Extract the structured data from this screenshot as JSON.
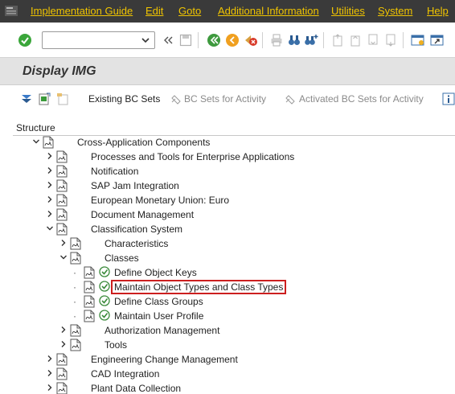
{
  "menu": {
    "items": [
      "Implementation Guide",
      "Edit",
      "Goto",
      "Additional Information",
      "Utilities",
      "System",
      "Help"
    ]
  },
  "toolbar": {
    "command_field_value": ""
  },
  "title": "Display IMG",
  "app_toolbar": {
    "existing_bc_sets": "Existing BC Sets",
    "bc_sets_for_activity": "BC Sets for Activity",
    "activated_bc_sets_for_activity": "Activated BC Sets for Activity"
  },
  "structure": {
    "header": "Structure",
    "nodes": [
      {
        "label": "Cross-Application Components",
        "state": "expanded"
      },
      {
        "label": "Processes and Tools for Enterprise Applications",
        "state": "collapsed"
      },
      {
        "label": "Notification",
        "state": "collapsed"
      },
      {
        "label": "SAP Jam Integration",
        "state": "collapsed"
      },
      {
        "label": "European Monetary Union: Euro",
        "state": "collapsed"
      },
      {
        "label": "Document Management",
        "state": "collapsed"
      },
      {
        "label": "Classification System",
        "state": "expanded"
      },
      {
        "label": "Characteristics",
        "state": "collapsed"
      },
      {
        "label": "Classes",
        "state": "expanded"
      },
      {
        "label": "Define Object Keys",
        "state": "leaf"
      },
      {
        "label": "Maintain Object Types and Class Types",
        "state": "leaf",
        "highlighted": true
      },
      {
        "label": "Define Class Groups",
        "state": "leaf"
      },
      {
        "label": "Maintain User Profile",
        "state": "leaf"
      },
      {
        "label": "Authorization Management",
        "state": "collapsed"
      },
      {
        "label": "Tools",
        "state": "collapsed"
      },
      {
        "label": "Engineering Change Management",
        "state": "collapsed"
      },
      {
        "label": "CAD Integration",
        "state": "collapsed"
      },
      {
        "label": "Plant Data Collection",
        "state": "collapsed"
      }
    ]
  },
  "colors": {
    "menubar_bg": "#3a3a3a",
    "menu_text": "#f0c400",
    "highlight_border": "#cc1f1f"
  }
}
